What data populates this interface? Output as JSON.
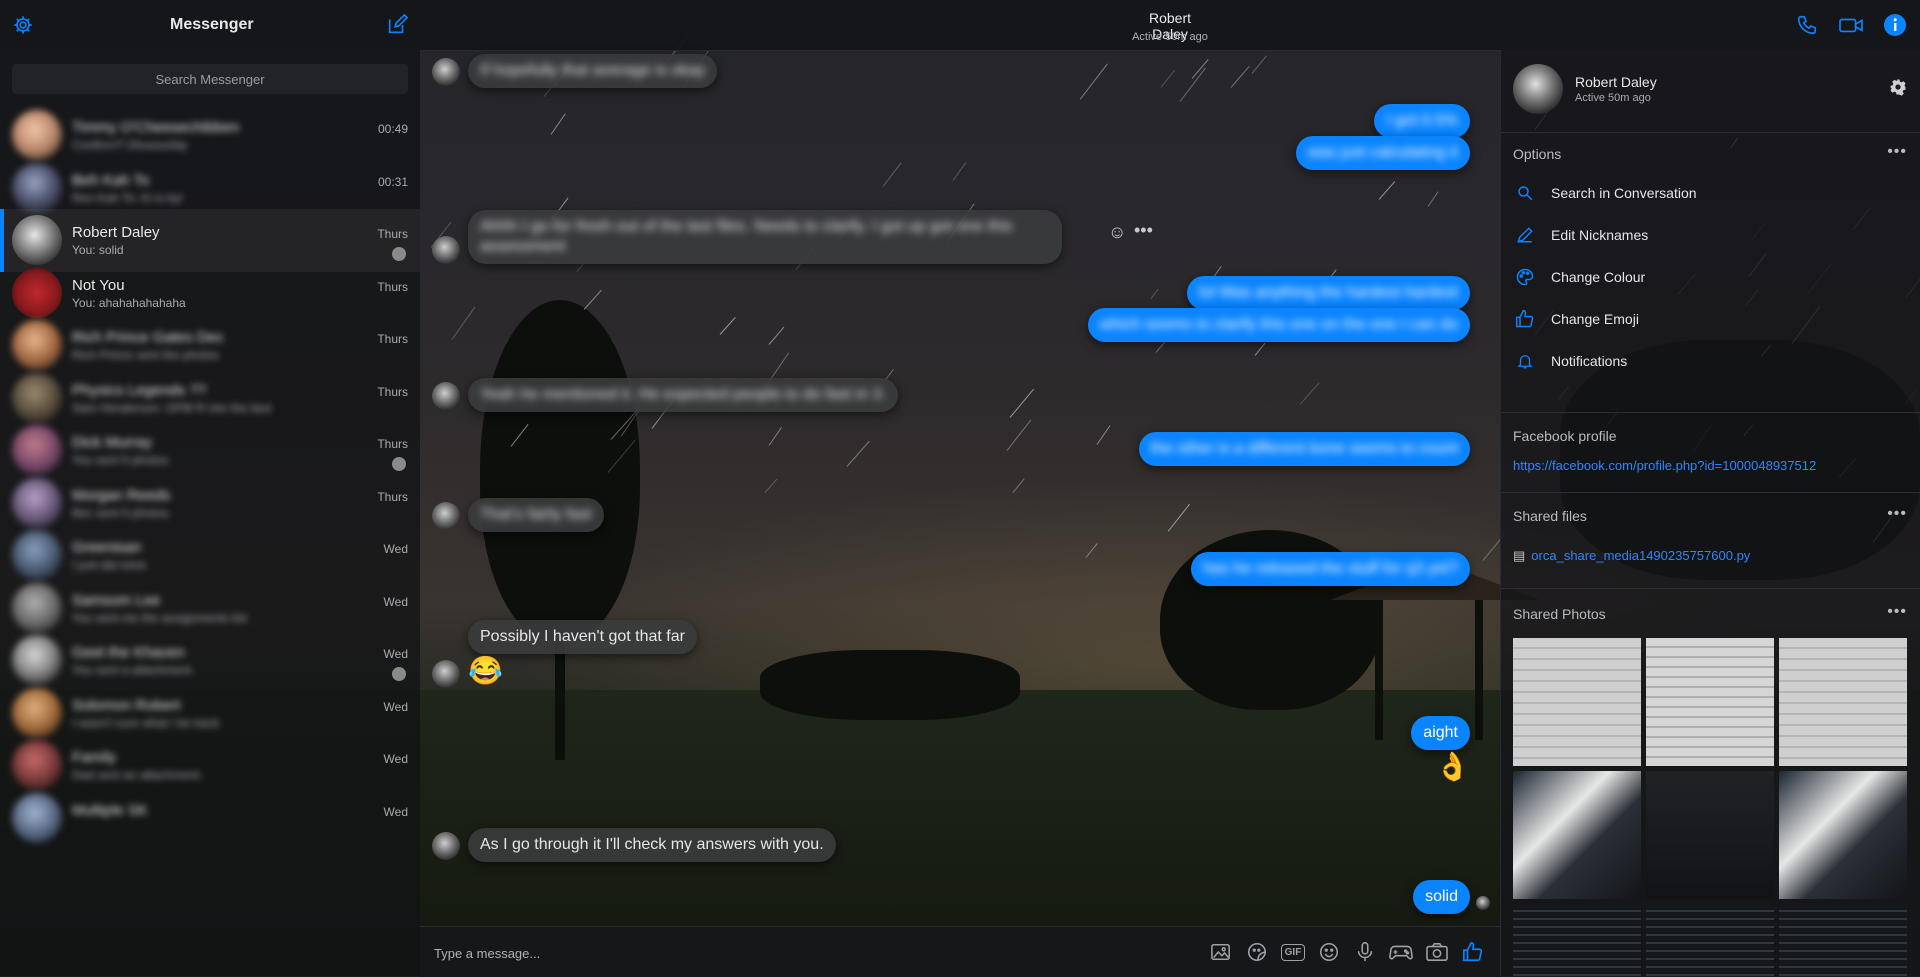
{
  "app": {
    "title": "Messenger",
    "settings_icon": "gear-icon",
    "compose_icon": "compose-icon"
  },
  "header": {
    "name": "Robert Daley",
    "status": "Active 50m ago",
    "icons": [
      "phone-icon",
      "video-icon",
      "info-icon"
    ]
  },
  "sidebar": {
    "search_placeholder": "Search Messenger",
    "conversations": [
      {
        "title": "Timmy O'Cheesechibben",
        "subtitle": "Confirm?! Dhussurbly",
        "time": "00:49",
        "blurred": true
      },
      {
        "title": "Beh Kah To",
        "subtitle": "Ren Kah To: Ki is by!",
        "time": "00:31",
        "blurred": true
      },
      {
        "title": "Robert Daley",
        "subtitle": "You: solid",
        "time": "Thurs",
        "blurred": false,
        "active": true
      },
      {
        "title": "Not You",
        "subtitle": "You: ahahahahahaha",
        "time": "Thurs",
        "blurred": false
      },
      {
        "title": "Rich Prince Gates Dec",
        "subtitle": "Rich Prince sent the photos",
        "time": "Thurs",
        "blurred": true
      },
      {
        "title": "Physics Legends ??",
        "subtitle": "Sam Henderson: OPM R into the bed",
        "time": "Thurs",
        "blurred": true
      },
      {
        "title": "Dick Murray",
        "subtitle": "You sent 5 photos.",
        "time": "Thurs",
        "blurred": true
      },
      {
        "title": "Morgan Reeds",
        "subtitle": "Bec sent 5 photos.",
        "time": "Thurs",
        "blurred": true
      },
      {
        "title": "Greenisan",
        "subtitle": "I just did mine",
        "time": "Wed",
        "blurred": true
      },
      {
        "title": "Samsom Lee",
        "subtitle": "You sent me the assignments list",
        "time": "Wed",
        "blurred": true
      },
      {
        "title": "Geet the Khaven",
        "subtitle": "You sent a attachment.",
        "time": "Wed",
        "blurred": true
      },
      {
        "title": "Solomon Robert",
        "subtitle": "I wasn't sure what I be back",
        "time": "Wed",
        "blurred": true
      },
      {
        "title": "Family",
        "subtitle": "Dad sent an attachment.",
        "time": "Wed",
        "blurred": true
      },
      {
        "title": "Multiple SK",
        "subtitle": "",
        "time": "Wed",
        "blurred": true
      }
    ]
  },
  "chat": {
    "messages": [
      {
        "dir": "in",
        "text": "If hopefully that average is okay",
        "blurred": true
      },
      {
        "dir": "out",
        "text": "I got 0.5%",
        "blurred": true
      },
      {
        "dir": "out",
        "text": "was just calculating it",
        "blurred": true
      },
      {
        "dir": "in",
        "text": "Ahhh I go for fresh out of the last files. Needs to clarify. I got up got one this assessment",
        "blurred": true
      },
      {
        "dir": "out",
        "text": "lol Was anything the hardest hardest",
        "blurred": true
      },
      {
        "dir": "out",
        "text": "which seems to clarify this one on the one I can do",
        "blurred": true
      },
      {
        "dir": "in",
        "text": "Yeah he mentioned it. He expected people to do fast in 3.",
        "blurred": true
      },
      {
        "dir": "out",
        "text": "the other is a different bone seems to count",
        "blurred": true
      },
      {
        "dir": "in",
        "text": "That's fairly fast",
        "blurred": true
      },
      {
        "dir": "out",
        "text": "has he released the stuff for q3 yet?",
        "blurred": true
      },
      {
        "dir": "in",
        "text": "Possibly I haven't got that far",
        "blurred": false
      },
      {
        "dir": "out",
        "text": "aight",
        "blurred": false
      },
      {
        "dir": "in",
        "text": "As I go through it I'll check my answers with you.",
        "blurred": false
      },
      {
        "dir": "out",
        "text": "solid",
        "blurred": false
      }
    ],
    "emojis": {
      "laugh": "😂",
      "ok": "👌"
    }
  },
  "composer": {
    "placeholder": "Type a message...",
    "gif_label": "GIF",
    "icons": [
      "image-icon",
      "sticker-icon",
      "gif-icon",
      "emoji-icon",
      "microphone-icon",
      "game-icon",
      "camera-icon",
      "like-icon"
    ]
  },
  "right_panel": {
    "name": "Robert Daley",
    "status": "Active 50m ago",
    "options_title": "Options",
    "options": [
      {
        "label": "Search in Conversation",
        "icon": "search-icon"
      },
      {
        "label": "Edit Nicknames",
        "icon": "pencil-icon"
      },
      {
        "label": "Change Colour",
        "icon": "palette-icon"
      },
      {
        "label": "Change Emoji",
        "icon": "thumbs-up-icon"
      },
      {
        "label": "Notifications",
        "icon": "bell-icon"
      }
    ],
    "profile_title": "Facebook profile",
    "profile_link": "https://facebook.com/profile.php?id=1000048937512",
    "files_title": "Shared files",
    "file_name": "orca_share_media1490235757600.py",
    "photos_title": "Shared Photos",
    "more_label": "•••"
  },
  "colors": {
    "accent": "#0a84ff",
    "bubble_in": "#3a3b3c",
    "bubble_out": "#0a84ff"
  }
}
